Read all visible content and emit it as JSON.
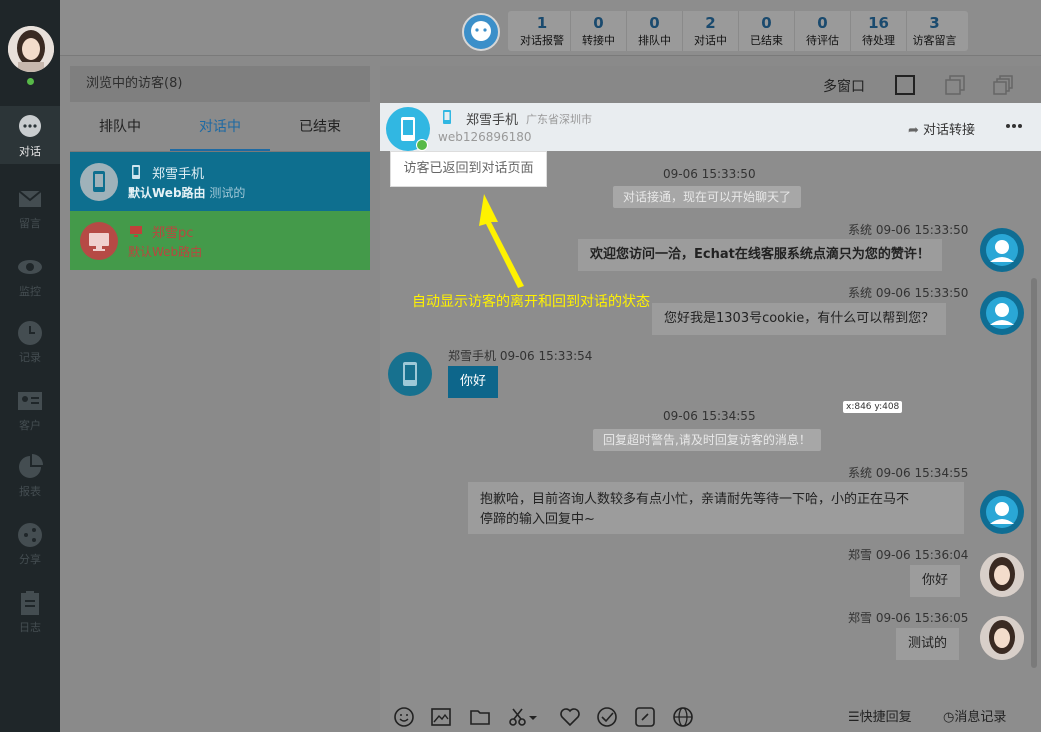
{
  "stats": [
    {
      "num": "1",
      "label": "对话报警"
    },
    {
      "num": "0",
      "label": "转接中"
    },
    {
      "num": "0",
      "label": "排队中"
    },
    {
      "num": "2",
      "label": "对话中"
    },
    {
      "num": "0",
      "label": "已结束"
    },
    {
      "num": "0",
      "label": "待评估"
    },
    {
      "num": "16",
      "label": "待处理"
    },
    {
      "num": "3",
      "label": "访客留言"
    }
  ],
  "nav": [
    {
      "label": "对话",
      "icon": "chat-icon"
    },
    {
      "label": "留言",
      "icon": "mail-icon"
    },
    {
      "label": "监控",
      "icon": "eye-icon"
    },
    {
      "label": "记录",
      "icon": "clock-icon"
    },
    {
      "label": "客户",
      "icon": "contact-card-icon"
    },
    {
      "label": "报表",
      "icon": "pie-chart-icon"
    },
    {
      "label": "分享",
      "icon": "share-icon"
    },
    {
      "label": "日志",
      "icon": "clipboard-icon"
    }
  ],
  "visitor_panel": {
    "title": "浏览中的访客(8)",
    "tabs": [
      "排队中",
      "对话中",
      "已结束"
    ],
    "items": [
      {
        "name": "郑雪手机",
        "sub_bold": "默认Web路由",
        "sub": "测试的"
      },
      {
        "name": "郑雪pc",
        "sub": "默认Web路由"
      }
    ]
  },
  "window_bar": {
    "label": "多窗口"
  },
  "chat_header": {
    "name": "郑雪手机",
    "location": "广东省深圳市",
    "visitor_id": "web126896180",
    "transfer_label": "对话转接"
  },
  "tooltip": "访客已返回到对话页面",
  "annotation": "自动显示访客的离开和回到对话的状态",
  "messages": {
    "t1": "09-06 15:33:50",
    "pill1": "对话接通，现在可以开始聊天了",
    "sys1_meta": "系统  09-06 15:33:50",
    "sys1_text": "欢迎您访问一洽，Echat在线客服系统点滴只为您的赞许！",
    "sys2_meta": "系统  09-06 15:33:50",
    "sys2_text": "您好我是1303号cookie，有什么可以帮到您？",
    "vis_meta": "郑雪手机  09-06 15:33:54",
    "vis_text": "你好",
    "t2": "09-06 15:34:55",
    "pill2": "回复超时警告,请及时回复访客的消息！",
    "sys3_meta": "系统  09-06 15:34:55",
    "sys3_line1": "抱歉哈，目前咨询人数较多有点小忙，亲请耐先等待一下哈，小的正在马不",
    "sys3_line2": "停蹄的输入回复中~",
    "agent1_meta": "郑雪  09-06 15:36:04",
    "agent1_text": "你好",
    "agent2_meta": "郑雪  09-06 15:36:05",
    "agent2_text": "测试的"
  },
  "coord": "x:846 y:408",
  "toolbar": {
    "quick_reply": "快捷回复",
    "history": "消息记录"
  }
}
